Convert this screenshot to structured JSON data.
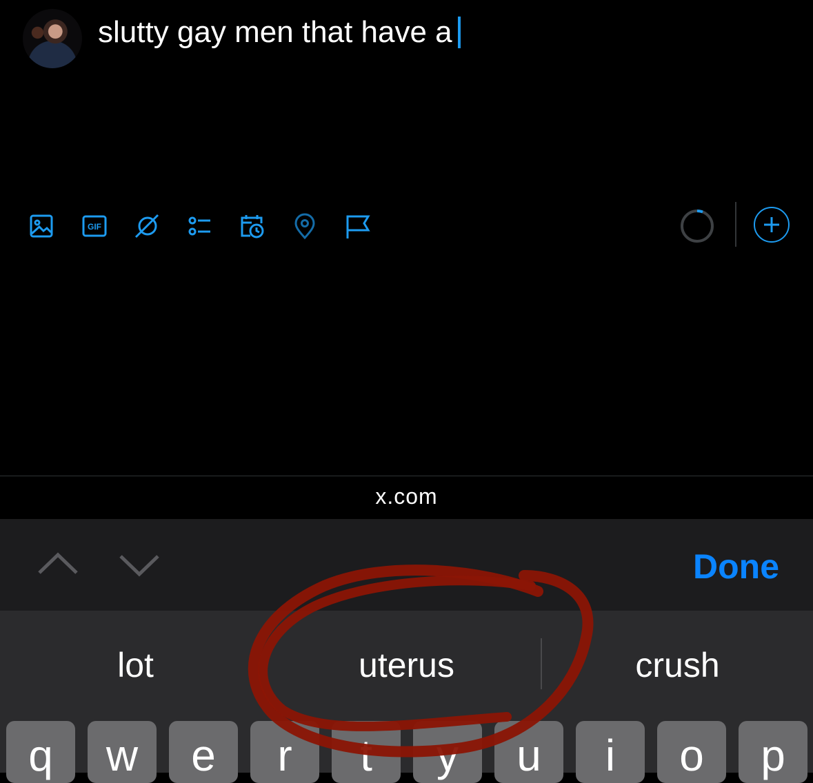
{
  "composer": {
    "text": "slutty gay men that have a",
    "tools": [
      {
        "name": "image-icon"
      },
      {
        "name": "gif-icon"
      },
      {
        "name": "grok-icon"
      },
      {
        "name": "poll-icon"
      },
      {
        "name": "schedule-icon"
      },
      {
        "name": "location-icon"
      },
      {
        "name": "flag-icon"
      }
    ],
    "gif_label": "GIF",
    "accent_color": "#1d9bf0"
  },
  "urlbar": {
    "domain": "x.com"
  },
  "accessory": {
    "done_label": "Done"
  },
  "suggestions": [
    "lot",
    "uterus",
    "crush"
  ],
  "keys": [
    "q",
    "w",
    "e",
    "r",
    "t",
    "y",
    "u",
    "i",
    "o",
    "p"
  ],
  "annotation": {
    "color": "#8b1505"
  }
}
